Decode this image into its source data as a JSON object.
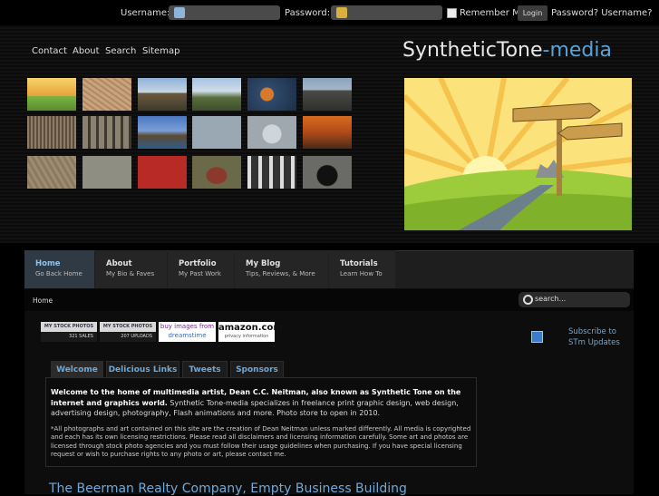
{
  "login": {
    "username_label": "Username:",
    "password_label": "Password:",
    "remember_label": "Remember Me",
    "login_button": "Login",
    "forgot_links": "Password? Username?"
  },
  "nav": [
    "Contact",
    "About",
    "Search",
    "Sitemap"
  ],
  "logo": {
    "main": "SyntheticTone",
    "accent": "-media",
    "accent_color": "#5aa3d8"
  },
  "menu": [
    {
      "title": "Home",
      "sub": "Go Back Home"
    },
    {
      "title": "About",
      "sub": "My Bio & Faves"
    },
    {
      "title": "Portfolio",
      "sub": "My Past Work"
    },
    {
      "title": "My Blog",
      "sub": "Tips, Reviews, & More"
    },
    {
      "title": "Tutorials",
      "sub": "Learn How To"
    }
  ],
  "breadcrumb": "Home",
  "search_placeholder": "search...",
  "badges": {
    "stock1": {
      "top": "MY STOCK PHOTOS",
      "bottom": "321 SALES"
    },
    "stock2": {
      "top": "MY STOCK PHOTOS",
      "bottom": "207 UPLOADS"
    },
    "dreamstime": {
      "line1": "buy images from",
      "line2": "dreamstime"
    },
    "amazon": {
      "brand": "amazon.com",
      "sub": "privacy information"
    }
  },
  "subscribe": {
    "line1": "Subscribe to",
    "line2": "STm Updates"
  },
  "tabs": [
    "Welcome",
    "Delicious Links",
    "Tweets",
    "Sponsors"
  ],
  "welcome": {
    "bold": "Welcome to the home of multimedia artist, Dean C.C. Neitman, also known as Synthetic Tone on the internet and graphics world.",
    "text": " Synthetic Tone-media specializes in freelance print graphic design, web design, advertising design, photography, Flash animations and more. Photo store to open in 2010.",
    "note": "*All photographs and art contained on this site are the creation of Dean Neitman unless marked differently. All media is copyrighted and each has its own licensing restrictions. Please read all disclaimers and licensing information carefully. Some art and photos are licensed through stock photo agencies and you must follow their usage guidelines when purchasing. If you have special licensing request or wish to purchase rights to any photo or art, please contact me."
  },
  "post_title": "The Beerman Realty Company, Empty Business Building"
}
